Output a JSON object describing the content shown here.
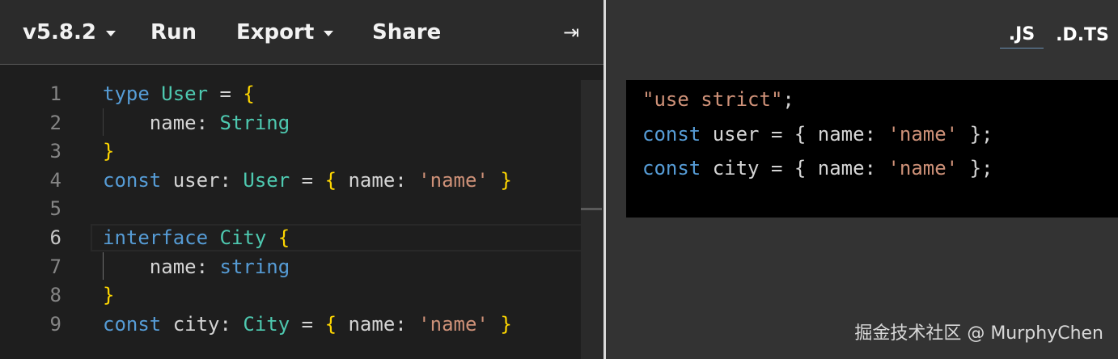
{
  "toolbar": {
    "version_label": "v5.8.2",
    "run_label": "Run",
    "export_label": "Export",
    "share_label": "Share",
    "collapse_glyph": "⇥"
  },
  "editor": {
    "active_line": 6,
    "lines": [
      {
        "num": "1",
        "tokens": [
          [
            "kw",
            "type"
          ],
          [
            "pl",
            " "
          ],
          [
            "ty",
            "User"
          ],
          [
            "pl",
            " = "
          ],
          [
            "br",
            "{"
          ]
        ]
      },
      {
        "num": "2",
        "tokens": [
          [
            "pl",
            "    name: "
          ],
          [
            "ty",
            "String"
          ]
        ]
      },
      {
        "num": "3",
        "tokens": [
          [
            "br",
            "}"
          ]
        ]
      },
      {
        "num": "4",
        "tokens": [
          [
            "kw",
            "const"
          ],
          [
            "pl",
            " user: "
          ],
          [
            "ty",
            "User"
          ],
          [
            "pl",
            " = "
          ],
          [
            "br",
            "{"
          ],
          [
            "pl",
            " name: "
          ],
          [
            "str",
            "'name'"
          ],
          [
            "pl",
            " "
          ],
          [
            "br",
            "}"
          ]
        ]
      },
      {
        "num": "5",
        "tokens": []
      },
      {
        "num": "6",
        "tokens": [
          [
            "kw",
            "interface"
          ],
          [
            "pl",
            " "
          ],
          [
            "ty",
            "City"
          ],
          [
            "pl",
            " "
          ],
          [
            "br",
            "{"
          ]
        ]
      },
      {
        "num": "7",
        "tokens": [
          [
            "pl",
            "    name: "
          ],
          [
            "kw",
            "string"
          ]
        ]
      },
      {
        "num": "8",
        "tokens": [
          [
            "br",
            "}"
          ]
        ]
      },
      {
        "num": "9",
        "tokens": [
          [
            "kw",
            "const"
          ],
          [
            "pl",
            " city: "
          ],
          [
            "ty",
            "City"
          ],
          [
            "pl",
            " = "
          ],
          [
            "br",
            "{"
          ],
          [
            "pl",
            " name: "
          ],
          [
            "str",
            "'name'"
          ],
          [
            "pl",
            " "
          ],
          [
            "br",
            "}"
          ]
        ]
      }
    ]
  },
  "output_tabs": {
    "js_label": ".JS",
    "dts_label": ".D.TS",
    "active": ".JS"
  },
  "output": {
    "lines": [
      {
        "tokens": [
          [
            "str",
            "\"use strict\""
          ],
          [
            "pl",
            ";"
          ]
        ]
      },
      {
        "tokens": [
          [
            "kw",
            "const"
          ],
          [
            "pl",
            " user = { name: "
          ],
          [
            "str",
            "'name'"
          ],
          [
            "pl",
            " };"
          ]
        ]
      },
      {
        "tokens": [
          [
            "kw",
            "const"
          ],
          [
            "pl",
            " city = { name: "
          ],
          [
            "str",
            "'name'"
          ],
          [
            "pl",
            " };"
          ]
        ]
      }
    ]
  },
  "watermark": "掘金技术社区 @ MurphyChen"
}
